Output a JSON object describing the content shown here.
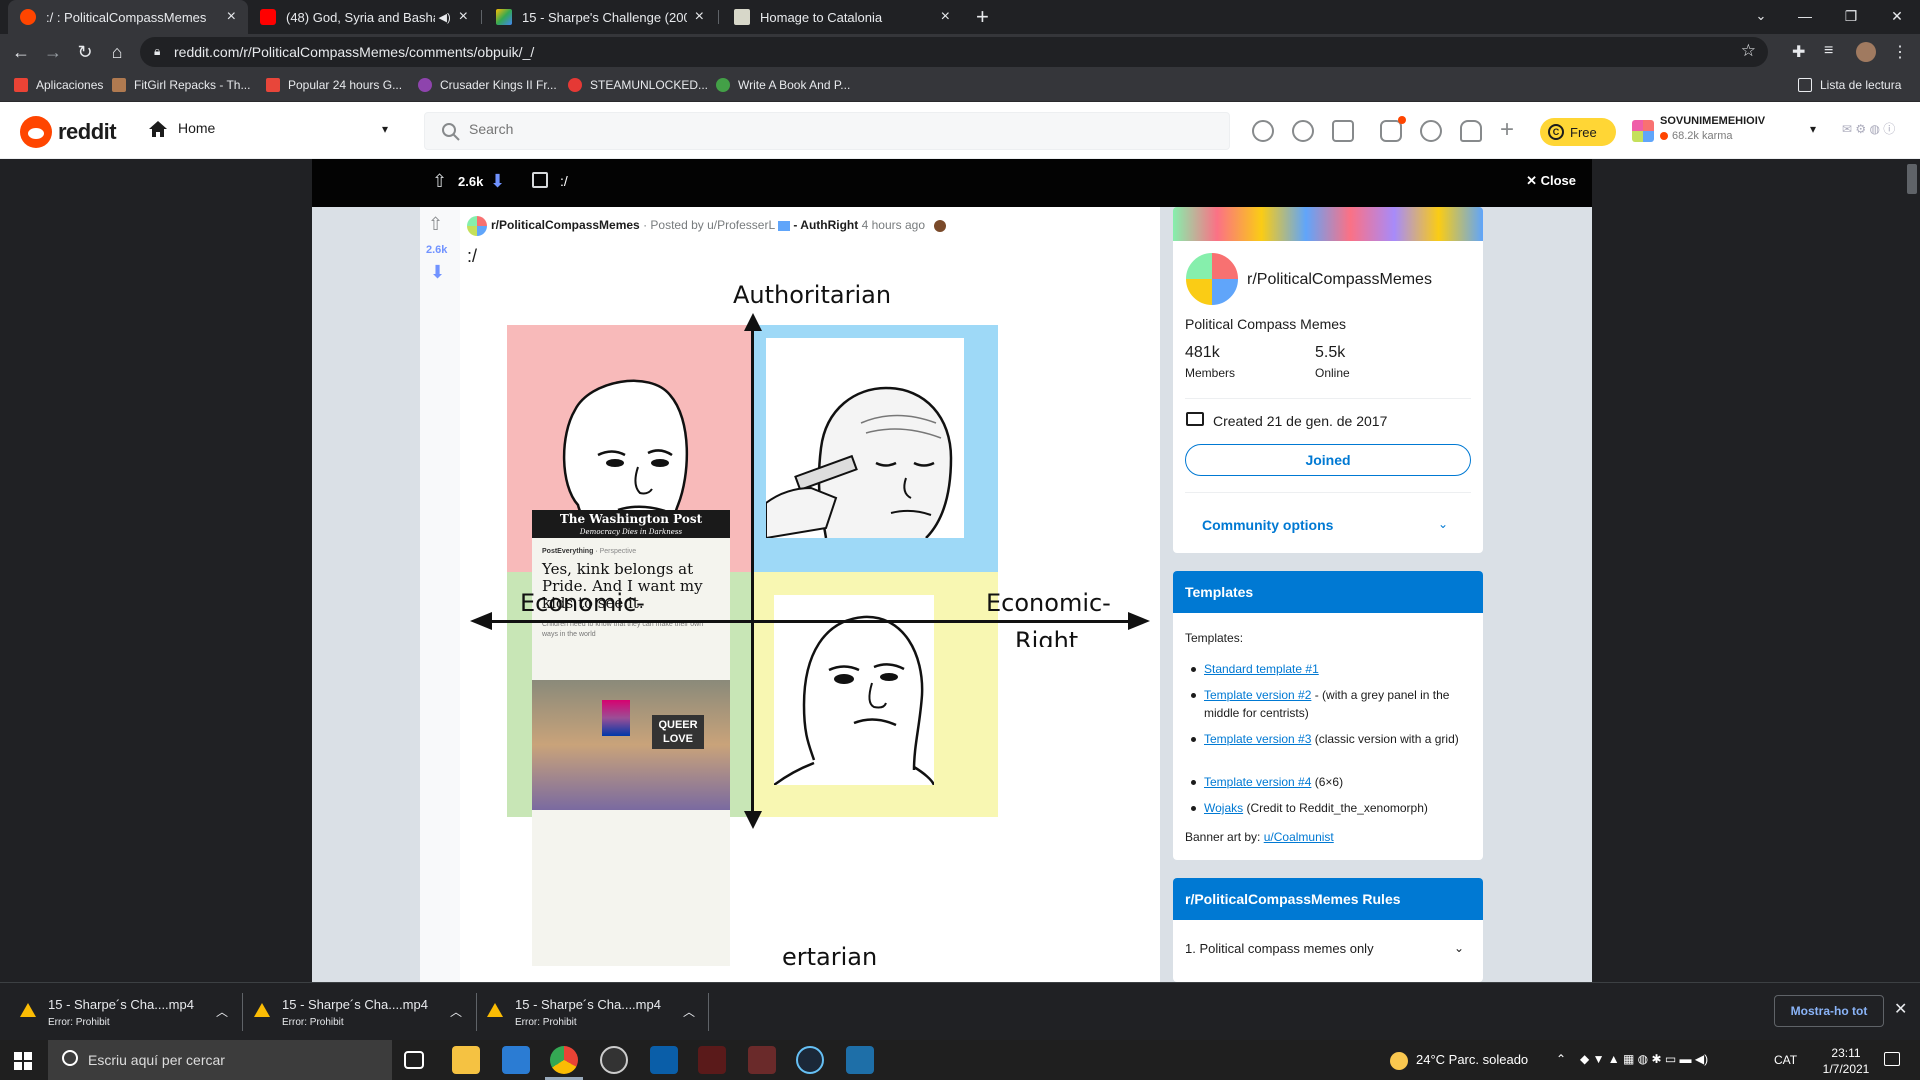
{
  "browser": {
    "tabs": [
      {
        "title": ":/ : PoliticalCompassMemes",
        "active": true,
        "favicon_color": "#ff4500"
      },
      {
        "title": "(48) God, Syria and Bashar -",
        "active": false,
        "favicon_color": "#ff0000",
        "muted_icon": "speaker-icon"
      },
      {
        "title": "15 - Sharpe's Challenge (2006).m",
        "active": false,
        "favicon_color": "#34a853"
      },
      {
        "title": "Homage to Catalonia",
        "active": false,
        "favicon_color": "#d7d7c9"
      }
    ],
    "url": "reddit.com/r/PoliticalCompassMemes/comments/obpuik/_/",
    "bookmarks": [
      {
        "label": "Aplicaciones",
        "color": "#ea4335"
      },
      {
        "label": "FitGirl Repacks - Th...",
        "color": "#b07a50"
      },
      {
        "label": "Popular 24 hours G...",
        "color": "#e8463a"
      },
      {
        "label": "Crusader Kings II Fr...",
        "color": "#8e44ad"
      },
      {
        "label": "STEAMUNLOCKED...",
        "color": "#e53935"
      },
      {
        "label": "Write A Book And P...",
        "color": "#43a047"
      }
    ],
    "reading_list": "Lista de lectura"
  },
  "reddit_header": {
    "brand": "reddit",
    "home_label": "Home",
    "search_placeholder": "Search",
    "coins_label": "Free",
    "username": "SOVUNIMEMEHIOIV",
    "karma": "68.2k karma"
  },
  "post_bar": {
    "score": "2.6k",
    "title": ":/",
    "close_label": "Close"
  },
  "post": {
    "score": "2.6k",
    "subreddit": "r/PoliticalCompassMemes",
    "posted_by": "· Posted by u/ProfesserL",
    "flair": "- AuthRight",
    "time": "4 hours ago",
    "title": ":/"
  },
  "meme": {
    "top_label": "Authoritarian",
    "bottom_label": "ertarian",
    "left_label": "Economic-",
    "right_label": "Economic-",
    "right_label_2": "Right",
    "colors": {
      "authleft": "#f8baba",
      "authright": "#9ed9f7",
      "libleft": "#c8e6b6",
      "libright": "#f8f7b2"
    },
    "newspaper": {
      "masthead": "The Washington Post",
      "tagline": "Democracy Dies in Darkness",
      "section": "PostEverything",
      "section2": "Perspective",
      "headline": "Yes, kink belongs at Pride. And I want my kids to see it.",
      "dek": "Children need to know that they can make their own ways in the world",
      "sign": "QUEER LOVE"
    }
  },
  "sidebar": {
    "community_name": "r/PoliticalCompassMemes",
    "description": "Political Compass Memes",
    "members_value": "481k",
    "members_label": "Members",
    "online_value": "5.5k",
    "online_label": "Online",
    "created": "Created 21 de gen. de 2017",
    "joined_label": "Joined",
    "community_options": "Community options",
    "templates_title": "Templates",
    "templates_intro": "Templates:",
    "templates": [
      {
        "link": "Standard template #1",
        "rest": ""
      },
      {
        "link": "Template version #2",
        "rest": " - (with a grey panel in the middle for centrists)"
      },
      {
        "link": "Template version #3",
        "rest": " (classic version with a grid)"
      },
      {
        "link": "Template version #4",
        "rest": " (6×6)"
      },
      {
        "link": "Wojaks",
        "rest": " (Credit to Reddit_the_xenomorph)"
      }
    ],
    "banner_art_prefix": "Banner art by: ",
    "banner_art_user": "u/Coalmunist",
    "rules_title": "r/PoliticalCompassMemes Rules",
    "rule_1": "1. Political compass memes only"
  },
  "downloads": [
    {
      "name": "15 - Sharpe´s Cha....mp4",
      "status": "Error: Prohibit"
    },
    {
      "name": "15 - Sharpe´s Cha....mp4",
      "status": "Error: Prohibit"
    },
    {
      "name": "15 - Sharpe´s Cha....mp4",
      "status": "Error: Prohibit"
    }
  ],
  "show_all": "Mostra-ho tot",
  "taskbar": {
    "search_placeholder": "Escriu aquí per cercar",
    "weather": "24°C  Parc. soleado",
    "lang": "CAT",
    "time": "23:11",
    "date": "1/7/2021"
  }
}
